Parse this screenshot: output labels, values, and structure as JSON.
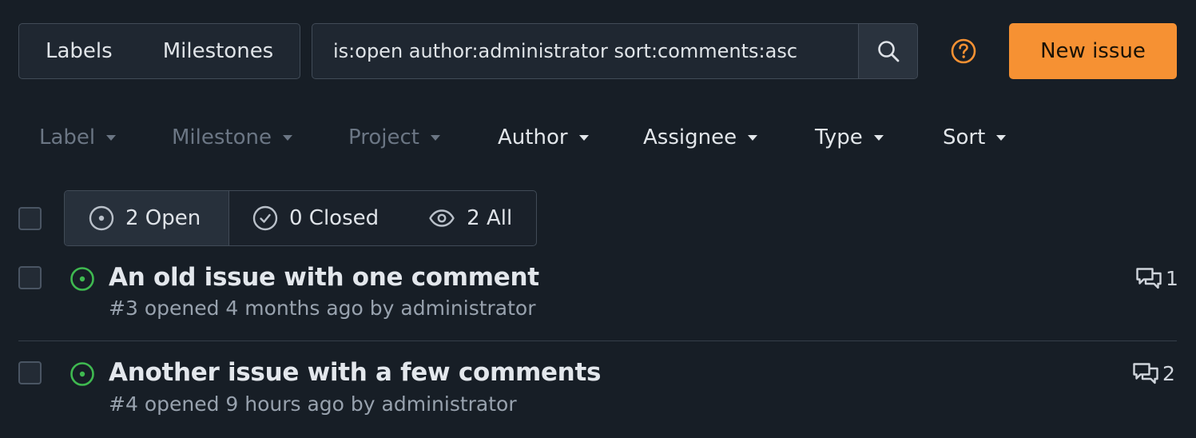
{
  "header": {
    "labels_label": "Labels",
    "milestones_label": "Milestones",
    "search_value": "is:open author:administrator sort:comments:asc",
    "new_issue_label": "New issue"
  },
  "filters": {
    "label": "Label",
    "milestone": "Milestone",
    "project": "Project",
    "author": "Author",
    "assignee": "Assignee",
    "type": "Type",
    "sort": "Sort"
  },
  "tabs": {
    "open": "2 Open",
    "closed": "0 Closed",
    "all": "2 All"
  },
  "issues": [
    {
      "title": "An old issue with one comment",
      "number": "#3",
      "opened_text": "opened 4 months ago by",
      "author": "administrator",
      "comments": "1"
    },
    {
      "title": "Another issue with a few comments",
      "number": "#4",
      "opened_text": "opened 9 hours ago by",
      "author": "administrator",
      "comments": "2"
    }
  ],
  "colors": {
    "background": "#171e26",
    "accent": "#f69133",
    "open_state": "#3fb950",
    "help_icon": "#f69133"
  },
  "icons": {
    "search": "search-icon",
    "help": "question-circle-icon",
    "open_state": "issue-open-icon",
    "closed_state": "check-circle-icon",
    "all_state": "eye-icon",
    "comments": "comments-icon"
  }
}
